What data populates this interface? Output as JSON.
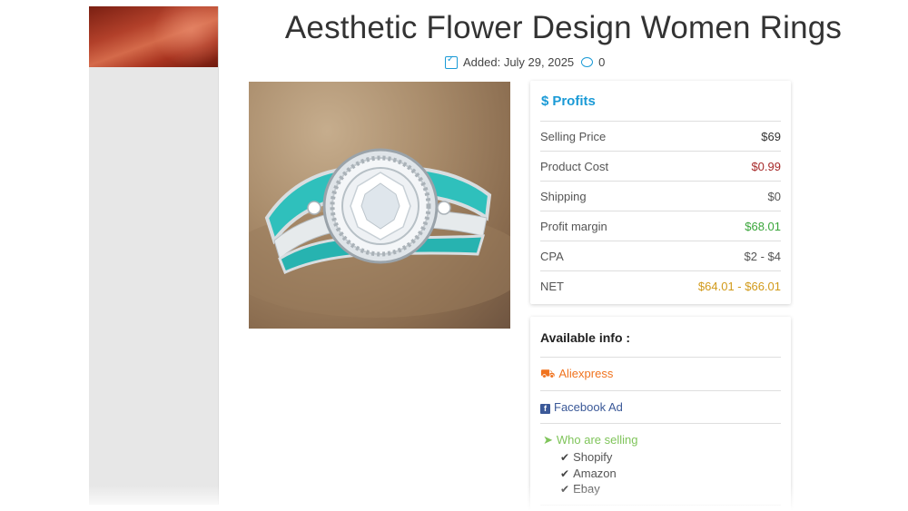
{
  "page": {
    "title": "Aesthetic Flower Design Women Rings",
    "added_label": "Added: July 29, 2025",
    "comment_count": "0"
  },
  "profits": {
    "heading": "Profits",
    "rows": [
      {
        "label": "Selling Price",
        "value": "$69",
        "color": "#333333"
      },
      {
        "label": "Product Cost",
        "value": "$0.99",
        "color": "#a72a2a"
      },
      {
        "label": "Shipping",
        "value": "$0",
        "color": "#555555"
      },
      {
        "label": "Profit margin",
        "value": "$68.01",
        "color": "#3aa53a"
      },
      {
        "label": "CPA",
        "value": "$2 - $4",
        "color": "#555555"
      },
      {
        "label": "NET",
        "value": "$64.01 - $66.01",
        "color": "#d19a1a"
      }
    ]
  },
  "info": {
    "heading": "Available info :",
    "aliexpress": "Aliexpress",
    "facebook_ad": "Facebook Ad",
    "who_selling": "Who are selling",
    "sellers": [
      "Shopify",
      "Amazon",
      "Ebay"
    ]
  },
  "colors": {
    "accent": "#1a9ad6",
    "aliexpress": "#f0731f",
    "facebook": "#3b5998",
    "who_selling": "#7fc45a"
  },
  "icons": [
    "calendar-check-icon",
    "comment-icon",
    "dollar-icon",
    "truck-icon",
    "facebook-icon",
    "location-arrow-icon",
    "check-icon"
  ]
}
